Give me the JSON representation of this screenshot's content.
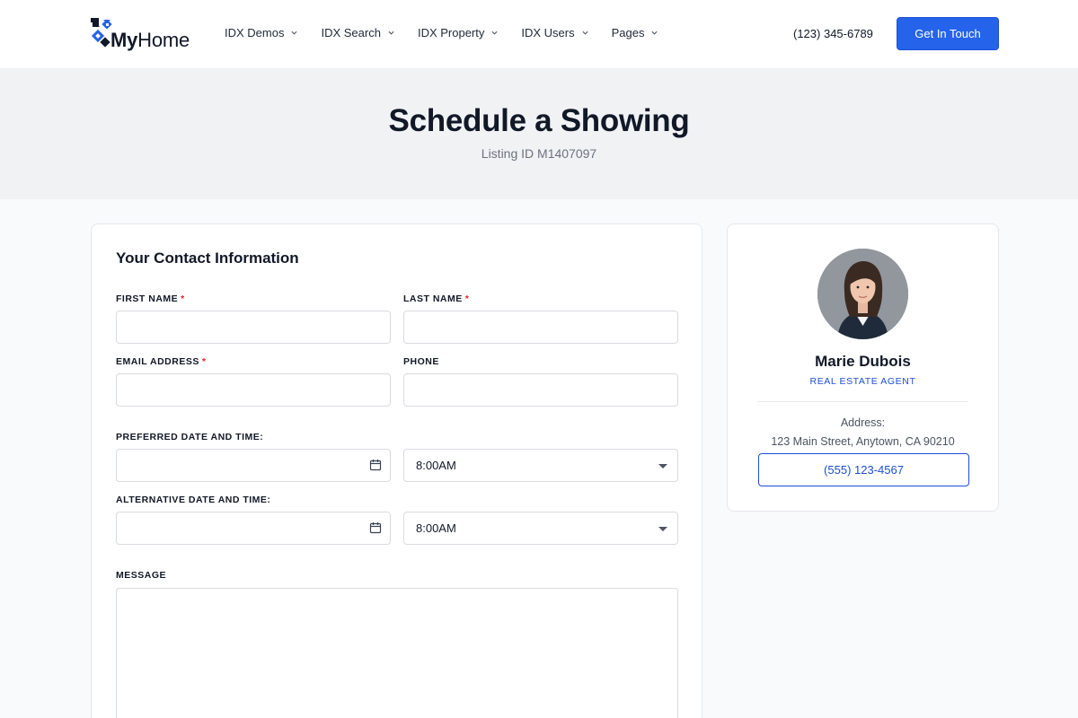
{
  "header": {
    "logo_my": "My",
    "logo_home": "Home",
    "nav": [
      {
        "label": "IDX Demos"
      },
      {
        "label": "IDX Search"
      },
      {
        "label": "IDX Property"
      },
      {
        "label": "IDX Users"
      },
      {
        "label": "Pages"
      }
    ],
    "phone": "(123) 345-6789",
    "cta_label": "Get In Touch"
  },
  "hero": {
    "title": "Schedule a Showing",
    "subtitle": "Listing ID M1407097"
  },
  "form": {
    "title": "Your Contact Information",
    "first_name_label": "FIRST NAME",
    "last_name_label": "LAST NAME",
    "email_label": "EMAIL ADDRESS",
    "phone_label": "PHONE",
    "required_mark": "*",
    "preferred_label": "PREFERRED DATE AND TIME:",
    "preferred_time": "8:00AM",
    "alternative_label": "ALTERNATIVE DATE AND TIME:",
    "alternative_time": "8:00AM",
    "message_label": "MESSAGE",
    "first_name_value": "",
    "last_name_value": "",
    "email_value": "",
    "phone_value": "",
    "message_value": ""
  },
  "agent": {
    "name": "Marie Dubois",
    "role": "REAL ESTATE AGENT",
    "address_label": "Address:",
    "address": "123 Main Street, Anytown, CA 90210",
    "phone": "(555) 123-4567"
  },
  "colors": {
    "accent": "#2563eb",
    "accent_dark": "#1d4ed8",
    "required": "#dc2626",
    "hero_bg": "#f1f2f4"
  },
  "icons": [
    "logo-icon",
    "chevron-down-icon",
    "calendar-icon",
    "caret-down-icon"
  ]
}
